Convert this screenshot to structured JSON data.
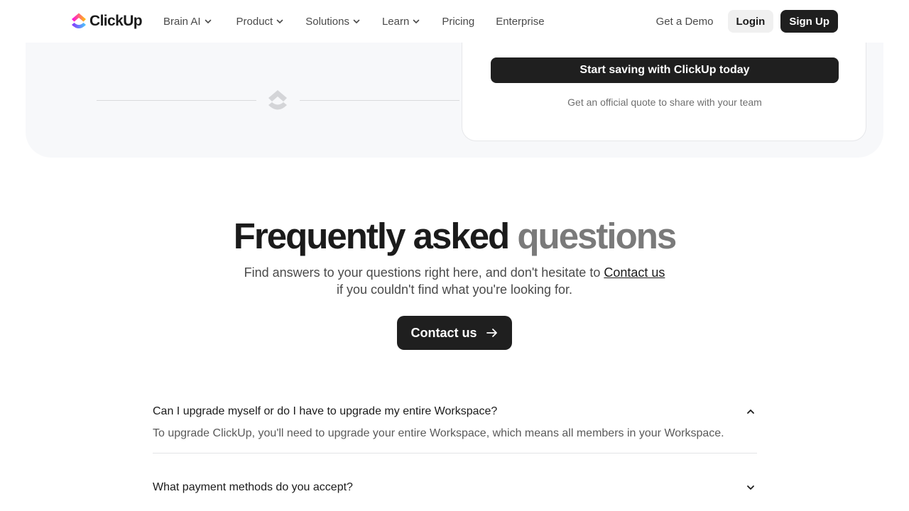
{
  "nav": {
    "logo_text": "ClickUp",
    "links": [
      {
        "label": "Brain AI",
        "dropdown": true
      },
      {
        "label": "Product",
        "dropdown": true
      },
      {
        "label": "Solutions",
        "dropdown": true
      },
      {
        "label": "Learn",
        "dropdown": true
      },
      {
        "label": "Pricing",
        "dropdown": false
      },
      {
        "label": "Enterprise",
        "dropdown": false
      }
    ],
    "demo_label": "Get a Demo",
    "login_label": "Login",
    "signup_label": "Sign Up"
  },
  "quote_card": {
    "cta_label": "Start saving with ClickUp today",
    "note": "Get an official quote to share with your team"
  },
  "faq": {
    "title_dark": "Frequently asked",
    "title_light": "questions",
    "subtitle_prefix": "Find answers to your questions right here, and don't hesitate to",
    "subtitle_link": "Contact us",
    "subtitle_suffix": "if you couldn't find what you're looking for.",
    "contact_button": "Contact us",
    "items": [
      {
        "question": "Can I upgrade myself or do I have to upgrade my entire Workspace?",
        "answer": "To upgrade ClickUp, you'll need to upgrade your entire Workspace, which means all members in your Workspace.",
        "expanded": true
      },
      {
        "question": "What payment methods do you accept?",
        "answer": "",
        "expanded": false
      }
    ]
  },
  "colors": {
    "primary_dark": "#1f1f1f",
    "panel_bg": "#f7f8fa",
    "muted_text": "#7a7a7a",
    "logo_gradient": [
      "#8930fd",
      "#49ccf9",
      "#ff02f0",
      "#ffc800"
    ]
  },
  "icons": {
    "dropdown": "chevron-down-icon",
    "expanded": "chevron-up-icon",
    "contact_arrow": "arrow-right-icon",
    "divider": "clickup-mark-icon"
  }
}
